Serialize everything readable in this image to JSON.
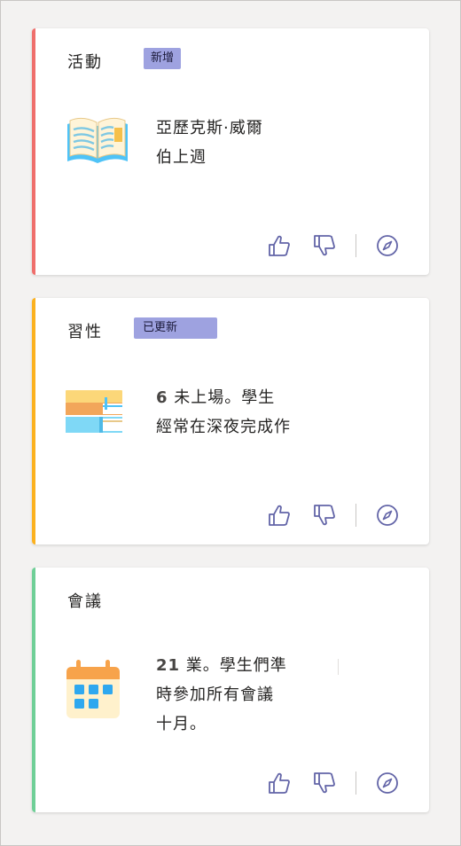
{
  "colors": {
    "accent_activity": "#ef6f6c",
    "accent_habit": "#fbb11f",
    "accent_meeting": "#6fcf97",
    "badge_bg": "#9ea2e0",
    "icon_stroke": "#6264a7"
  },
  "cards": [
    {
      "title": "活動",
      "badge": "新增",
      "illustration": "open-book-icon",
      "lines": [
        "亞歷克斯·威爾",
        "伯上週"
      ],
      "actions": {
        "like": "thumbs-up-icon",
        "dislike": "thumbs-down-icon",
        "explore": "compass-icon"
      }
    },
    {
      "title": "習性",
      "badge": "已更新",
      "illustration": "book-stack-icon",
      "number": "6",
      "lines": [
        "未上場。學生",
        "經常在深夜完成作"
      ],
      "actions": {
        "like": "thumbs-up-icon",
        "dislike": "thumbs-down-icon",
        "explore": "compass-icon"
      }
    },
    {
      "title": "會議",
      "illustration": "calendar-icon",
      "number": "21",
      "lines": [
        "業。學生們準",
        "時參加所有會議",
        "十月。"
      ],
      "actions": {
        "like": "thumbs-up-icon",
        "dislike": "thumbs-down-icon",
        "explore": "compass-icon"
      }
    }
  ]
}
